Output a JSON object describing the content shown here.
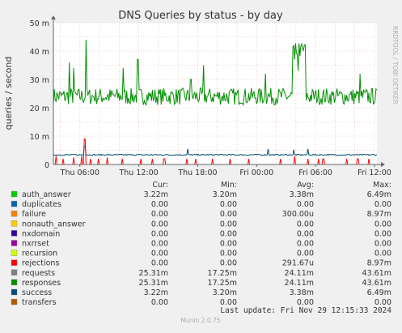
{
  "title": "DNS Queries by status - by day",
  "watermark": "RRDTOOL / TOBI OETIKER",
  "footer": "Munin 2.0.75",
  "last_update": "Last update: Fri Nov 29 12:15:33 2024",
  "colors": {
    "background": "#f0f0f0",
    "plot_bg": "#ffffff",
    "grid": "#e6b4b4",
    "requests": "#00a000",
    "success": "#004d6b",
    "rejections": "#ff0000"
  },
  "legend_headers": {
    "cur": "Cur:",
    "min": "Min:",
    "avg": "Avg:",
    "max": "Max:"
  },
  "legend_rows": [
    {
      "name": "auth_answer",
      "color": "#00cc00",
      "cur": "3.22m",
      "min": "3.20m",
      "avg": "3.38m",
      "max": "6.49m"
    },
    {
      "name": "duplicates",
      "color": "#0066b3",
      "cur": "0.00",
      "min": "0.00",
      "avg": "0.00",
      "max": "0.00"
    },
    {
      "name": "failure",
      "color": "#ff8000",
      "cur": "0.00",
      "min": "0.00",
      "avg": "300.00u",
      "max": "8.97m"
    },
    {
      "name": "nonauth_answer",
      "color": "#ffcc00",
      "cur": "0.00",
      "min": "0.00",
      "avg": "0.00",
      "max": "0.00"
    },
    {
      "name": "nxdomain",
      "color": "#330099",
      "cur": "0.00",
      "min": "0.00",
      "avg": "0.00",
      "max": "0.00"
    },
    {
      "name": "nxrrset",
      "color": "#990099",
      "cur": "0.00",
      "min": "0.00",
      "avg": "0.00",
      "max": "0.00"
    },
    {
      "name": "recursion",
      "color": "#ccff00",
      "cur": "0.00",
      "min": "0.00",
      "avg": "0.00",
      "max": "0.00"
    },
    {
      "name": "rejections",
      "color": "#ff0000",
      "cur": "0.00",
      "min": "0.00",
      "avg": "291.67u",
      "max": "8.97m"
    },
    {
      "name": "requests",
      "color": "#808080",
      "cur": "25.31m",
      "min": "17.25m",
      "avg": "24.11m",
      "max": "43.61m"
    },
    {
      "name": "responses",
      "color": "#008f00",
      "cur": "25.31m",
      "min": "17.25m",
      "avg": "24.11m",
      "max": "43.61m"
    },
    {
      "name": "success",
      "color": "#00487d",
      "cur": "3.22m",
      "min": "3.20m",
      "avg": "3.38m",
      "max": "6.49m"
    },
    {
      "name": "transfers",
      "color": "#b35a00",
      "cur": "0.00",
      "min": "0.00",
      "avg": "0.00",
      "max": "0.00"
    }
  ],
  "chart_data": {
    "type": "line",
    "title": "DNS Queries by status - by day",
    "ylabel": "queries / second",
    "xlabel": "",
    "ylim": [
      0,
      0.05
    ],
    "y_ticks": [
      0,
      0.01,
      0.02,
      0.03,
      0.04,
      0.05
    ],
    "y_tick_labels": [
      "0",
      "10 m",
      "20 m",
      "30 m",
      "40 m",
      "50 m"
    ],
    "x_ticks": [
      "Thu 06:00",
      "Thu 12:00",
      "Thu 18:00",
      "Fri 00:00",
      "Fri 06:00",
      "Fri 12:00"
    ],
    "x_range_hours": [
      3.3,
      36.25
    ],
    "x_tick_hours": [
      6,
      12,
      18,
      24,
      30,
      36
    ],
    "grid": true,
    "series": [
      {
        "name": "responses",
        "color": "#008f00",
        "baseline": 0.024,
        "spikes": [
          [
            4.9,
            0.036
          ],
          [
            5.4,
            0.034
          ],
          [
            6.6,
            0.044
          ],
          [
            10.4,
            0.034
          ],
          [
            11.9,
            0.037
          ],
          [
            17.3,
            0.03
          ],
          [
            18.6,
            0.035
          ],
          [
            24.9,
            0.032
          ],
          [
            27.9,
            0.037
          ],
          [
            28.2,
            0.033
          ],
          [
            34.5,
            0.032
          ]
        ],
        "plateau": {
          "from": 27.6,
          "to": 29.0,
          "value": 0.04
        }
      },
      {
        "name": "success",
        "color": "#004d6b",
        "baseline": 0.0034,
        "spikes": [
          [
            6.5,
            0.0065
          ],
          [
            17.0,
            0.0055
          ],
          [
            25.2,
            0.0055
          ],
          [
            27.8,
            0.0052
          ],
          [
            29.2,
            0.0055
          ]
        ]
      },
      {
        "name": "rejections",
        "color": "#ff0000",
        "baseline": 0,
        "spikes": [
          [
            3.6,
            0.003
          ],
          [
            4.3,
            0.002
          ],
          [
            5.4,
            0.0025
          ],
          [
            6.2,
            0.003
          ],
          [
            6.5,
            0.009
          ],
          [
            7.1,
            0.002
          ],
          [
            7.9,
            0.002
          ],
          [
            8.8,
            0.0025
          ],
          [
            10.3,
            0.002
          ],
          [
            12.2,
            0.002
          ],
          [
            13.4,
            0.002
          ],
          [
            14.6,
            0.002
          ],
          [
            16.9,
            0.002
          ],
          [
            17.8,
            0.002
          ],
          [
            19.5,
            0.002
          ],
          [
            21.3,
            0.002
          ],
          [
            23.2,
            0.002
          ],
          [
            26.4,
            0.002
          ],
          [
            27.9,
            0.003
          ],
          [
            29.2,
            0.002
          ],
          [
            30.3,
            0.002
          ],
          [
            30.8,
            0.002
          ],
          [
            33.2,
            0.002
          ],
          [
            34.3,
            0.002
          ],
          [
            35.4,
            0.002
          ]
        ]
      }
    ]
  }
}
